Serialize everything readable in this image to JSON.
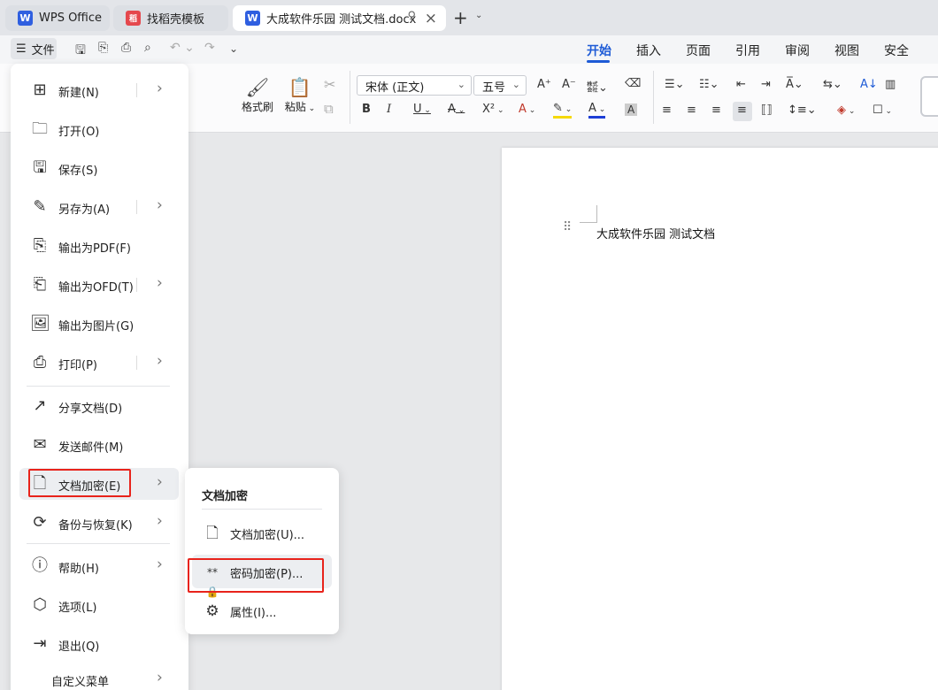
{
  "tabs": [
    {
      "label": "WPS Office",
      "logo": "W"
    },
    {
      "label": "找稻壳模板",
      "logo": "稻"
    },
    {
      "label": "大成软件乐园 测试文档.docx",
      "logo": "W"
    }
  ],
  "menubar": {
    "file_label": "文件",
    "ribbon_tabs": [
      "开始",
      "插入",
      "页面",
      "引用",
      "审阅",
      "视图",
      "安全"
    ]
  },
  "ribbon": {
    "format_painter": "格式刷",
    "paste": "粘贴",
    "font_name": "宋体 (正文)",
    "font_size": "五号"
  },
  "document": {
    "text": "大成软件乐园 测试文档"
  },
  "file_menu": {
    "items": [
      {
        "label": "新建(N)",
        "icon": "new-doc-icon"
      },
      {
        "label": "打开(O)",
        "icon": "folder-icon"
      },
      {
        "label": "保存(S)",
        "icon": "save-icon"
      },
      {
        "label": "另存为(A)",
        "icon": "save-as-icon"
      },
      {
        "label": "输出为PDF(F)",
        "icon": "pdf-icon"
      },
      {
        "label": "输出为OFD(T)",
        "icon": "ofd-icon"
      },
      {
        "label": "输出为图片(G)",
        "icon": "image-icon"
      },
      {
        "label": "打印(P)",
        "icon": "printer-icon"
      },
      {
        "label": "分享文档(D)",
        "icon": "share-icon"
      },
      {
        "label": "发送邮件(M)",
        "icon": "mail-icon"
      },
      {
        "label": "文档加密(E)",
        "icon": "encrypt-doc-icon"
      },
      {
        "label": "备份与恢复(K)",
        "icon": "backup-icon"
      },
      {
        "label": "帮助(H)",
        "icon": "help-icon"
      },
      {
        "label": "选项(L)",
        "icon": "options-icon"
      },
      {
        "label": "退出(Q)",
        "icon": "exit-icon"
      },
      {
        "label": "自定义菜单",
        "icon": ""
      }
    ]
  },
  "submenu": {
    "title": "文档加密",
    "items": [
      {
        "label": "文档加密(U)...",
        "icon": "encrypt-doc-icon"
      },
      {
        "label": "密码加密(P)...",
        "icon": "password-lock-icon"
      },
      {
        "label": "属性(I)...",
        "icon": "properties-icon"
      }
    ]
  },
  "colors": {
    "accent": "#1e5bd6",
    "highlight_box": "#e8231b",
    "wps_logo": "#2f5fe0",
    "docer_logo": "#e5484d"
  }
}
